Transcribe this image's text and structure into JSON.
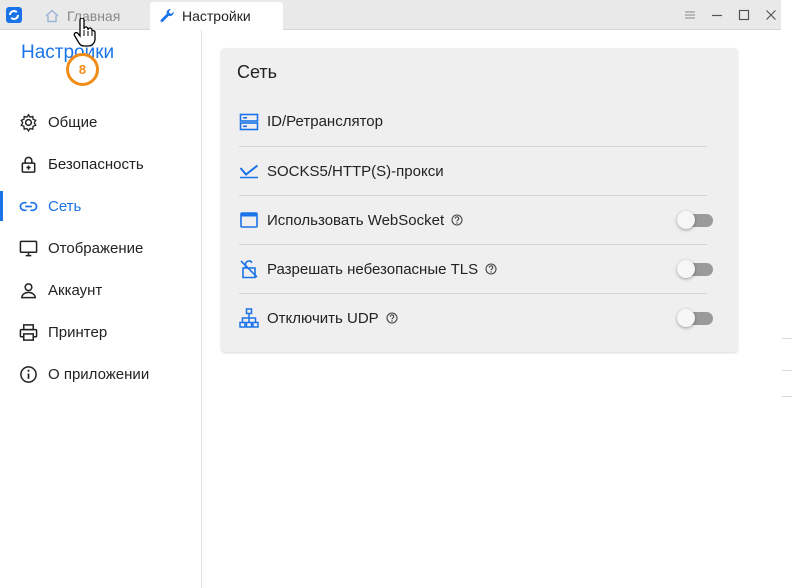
{
  "titlebar": {
    "tabs": [
      {
        "label": "Главная",
        "icon": "home-icon",
        "active": false
      },
      {
        "label": "Настройки",
        "icon": "wrench-icon",
        "active": true
      }
    ],
    "controls": [
      "menu-icon",
      "minimize-icon",
      "maximize-icon",
      "close-icon"
    ]
  },
  "sidebar": {
    "title": "Настройки",
    "items": [
      {
        "label": "Общие",
        "icon": "gear-icon"
      },
      {
        "label": "Безопасность",
        "icon": "lock-icon"
      },
      {
        "label": "Сеть",
        "icon": "link-icon",
        "active": true
      },
      {
        "label": "Отображение",
        "icon": "monitor-icon"
      },
      {
        "label": "Аккаунт",
        "icon": "user-icon"
      },
      {
        "label": "Принтер",
        "icon": "printer-icon"
      },
      {
        "label": "О приложении",
        "icon": "info-icon"
      }
    ]
  },
  "network": {
    "title": "Сеть",
    "rows": [
      {
        "label": "ID/Ретранслятор",
        "icon": "server-icon"
      },
      {
        "label": "SOCKS5/HTTP(S)-прокси",
        "icon": "proxy-icon"
      },
      {
        "label": "Использовать WebSocket",
        "icon": "window-icon",
        "help": true,
        "toggle": false
      },
      {
        "label": "Разрешать небезопасные TLS",
        "icon": "unlock-shield-icon",
        "help": true,
        "toggle": false
      },
      {
        "label": "Отключить UDP",
        "icon": "network-tree-icon",
        "help": true,
        "toggle": false
      }
    ]
  },
  "overlay": {
    "step_badge": "8"
  },
  "colors": {
    "accent": "#1a73e8",
    "badge": "#f08c19",
    "toggle_off": "#9a9a9a",
    "card_bg": "#efeff0"
  }
}
